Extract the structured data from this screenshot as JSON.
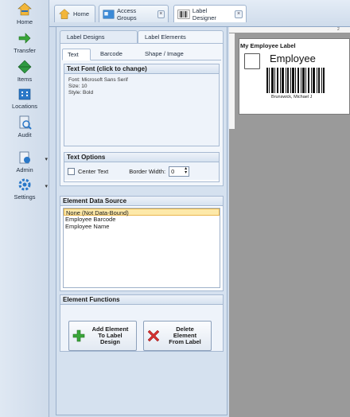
{
  "nav": {
    "items": [
      {
        "label": "Home",
        "icon": "home-icon"
      },
      {
        "label": "Transfer",
        "icon": "transfer-icon"
      },
      {
        "label": "Items",
        "icon": "items-icon"
      },
      {
        "label": "Locations",
        "icon": "locations-icon"
      },
      {
        "label": "Audit",
        "icon": "audit-icon"
      },
      {
        "label": "Admin",
        "icon": "admin-icon"
      },
      {
        "label": "Settings",
        "icon": "settings-icon"
      }
    ]
  },
  "doc_tabs": [
    {
      "label": "Home"
    },
    {
      "label": "Access Groups"
    },
    {
      "label": "Label Designer"
    }
  ],
  "panel": {
    "outer_tabs": [
      "Label Designs",
      "Label Elements"
    ],
    "inner_tabs": [
      "Text",
      "Barcode",
      "Shape / Image"
    ],
    "text_font": {
      "title": "Text Font (click to change)",
      "font": "Font: Microsoft Sans Serif",
      "size": "Size: 10",
      "style": "Style: Bold"
    },
    "text_options": {
      "title": "Text Options",
      "center_text": "Center Text",
      "border_width_label": "Border Width:",
      "border_width_value": "0"
    },
    "data_source": {
      "title": "Element Data Source",
      "items": [
        "None (Not Data-Bound)",
        "Employee Barcode",
        "Employee Name"
      ]
    },
    "functions": {
      "title": "Element Functions",
      "add": "Add Element\nTo Label\nDesign",
      "delete": "Delete\nElement\nFrom Label"
    }
  },
  "preview": {
    "ruler_mark": "2",
    "label_title": "My Employee Label",
    "employee_text": "Employee",
    "employee_name": "Brunswick, Michael J"
  },
  "colors": {
    "accent": "#d5e1ef",
    "selected_item": "#fde9a9",
    "add_icon": "#3aa63a",
    "delete_icon": "#d23030"
  }
}
